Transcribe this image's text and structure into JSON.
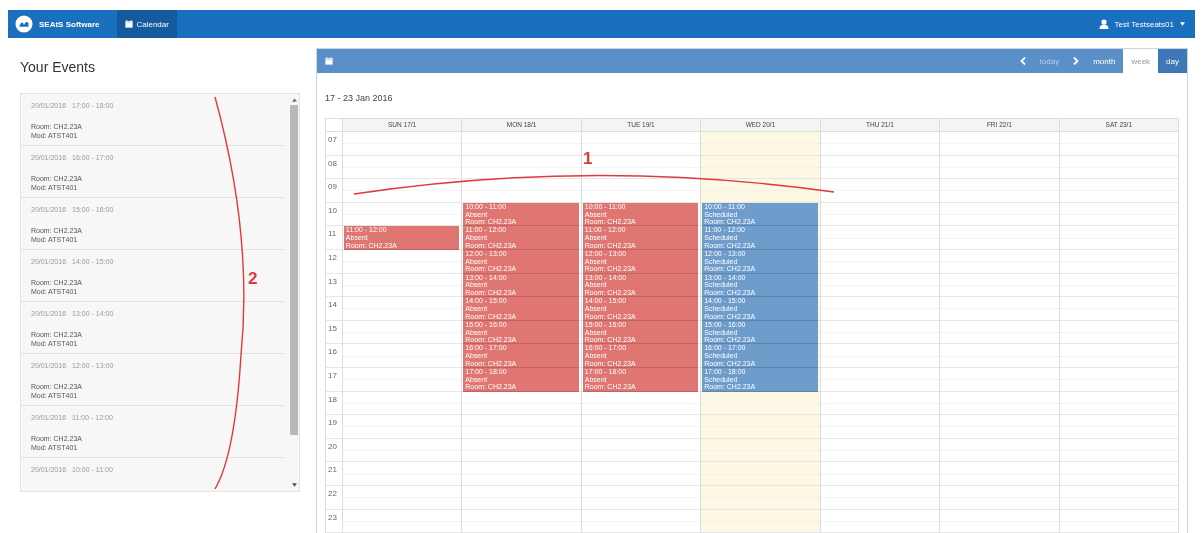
{
  "navbar": {
    "brand": "SEAtS Software",
    "items": [
      {
        "label": "Calendar",
        "selected": true
      }
    ],
    "user": "Test Testseats01"
  },
  "events_panel": {
    "title": "Your Events",
    "items": [
      {
        "date": "20/01/2016",
        "time": "17:00 - 18:00",
        "room": "Room: CH2.23A",
        "module": "Mod: ATST401"
      },
      {
        "date": "20/01/2016",
        "time": "16:00 - 17:00",
        "room": "Room: CH2.23A",
        "module": "Mod: ATST401"
      },
      {
        "date": "20/01/2016",
        "time": "15:00 - 16:00",
        "room": "Room: CH2.23A",
        "module": "Mod: ATST401"
      },
      {
        "date": "20/01/2016",
        "time": "14:00 - 15:00",
        "room": "Room: CH2.23A",
        "module": "Mod: ATST401"
      },
      {
        "date": "20/01/2016",
        "time": "13:00 - 14:00",
        "room": "Room: CH2.23A",
        "module": "Mod: ATST401"
      },
      {
        "date": "20/01/2016",
        "time": "12:00 - 13:00",
        "room": "Room: CH2.23A",
        "module": "Mod: ATST401"
      },
      {
        "date": "20/01/2016",
        "time": "11:00 - 12:00",
        "room": "Room: CH2.23A",
        "module": "Mod: ATST401"
      },
      {
        "date": "20/01/2016",
        "time": "10:00 - 11:00"
      }
    ]
  },
  "calendar": {
    "today_button": {
      "label": "today",
      "disabled": true
    },
    "views": [
      {
        "label": "month",
        "selected": false
      },
      {
        "label": "week",
        "selected": true
      },
      {
        "label": "day",
        "selected": false
      }
    ],
    "range_title": "17 - 23 Jan 2016",
    "hours": [
      "07",
      "08",
      "09",
      "10",
      "11",
      "12",
      "13",
      "14",
      "15",
      "16",
      "17",
      "18",
      "19",
      "20",
      "21",
      "22",
      "23"
    ],
    "columns": [
      {
        "label": "SUN 17/1",
        "today": false,
        "events": [
          {
            "kind": "absent",
            "time": "11:00 - 12:00",
            "status": "Absent",
            "room": "Room: CH2.23A"
          }
        ]
      },
      {
        "label": "MON 18/1",
        "today": false,
        "events": [
          {
            "kind": "absent",
            "time": "10:00 - 11:00",
            "status": "Absent",
            "room": "Room: CH2.23A"
          },
          {
            "kind": "absent",
            "time": "11:00 - 12:00",
            "status": "Absent",
            "room": "Room: CH2.23A"
          },
          {
            "kind": "absent",
            "time": "12:00 - 13:00",
            "status": "Absent",
            "room": "Room: CH2.23A"
          },
          {
            "kind": "absent",
            "time": "13:00 - 14:00",
            "status": "Absent",
            "room": "Room: CH2.23A"
          },
          {
            "kind": "absent",
            "time": "14:00 - 15:00",
            "status": "Absent",
            "room": "Room: CH2.23A"
          },
          {
            "kind": "absent",
            "time": "15:00 - 16:00",
            "status": "Absent",
            "room": "Room: CH2.23A"
          },
          {
            "kind": "absent",
            "time": "16:00 - 17:00",
            "status": "Absent",
            "room": "Room: CH2.23A"
          },
          {
            "kind": "absent",
            "time": "17:00 - 18:00",
            "status": "Absent",
            "room": "Room: CH2.23A"
          }
        ]
      },
      {
        "label": "TUE 19/1",
        "today": false,
        "events": [
          {
            "kind": "absent",
            "time": "10:00 - 11:00",
            "status": "Absent",
            "room": "Room: CH2.23A"
          },
          {
            "kind": "absent",
            "time": "11:00 - 12:00",
            "status": "Absent",
            "room": "Room: CH2.23A"
          },
          {
            "kind": "absent",
            "time": "12:00 - 13:00",
            "status": "Absent",
            "room": "Room: CH2.23A"
          },
          {
            "kind": "absent",
            "time": "13:00 - 14:00",
            "status": "Absent",
            "room": "Room: CH2.23A"
          },
          {
            "kind": "absent",
            "time": "14:00 - 15:00",
            "status": "Absent",
            "room": "Room: CH2.23A"
          },
          {
            "kind": "absent",
            "time": "15:00 - 16:00",
            "status": "Absent",
            "room": "Room: CH2.23A"
          },
          {
            "kind": "absent",
            "time": "16:00 - 17:00",
            "status": "Absent",
            "room": "Room: CH2.23A"
          },
          {
            "kind": "absent",
            "time": "17:00 - 18:00",
            "status": "Absent",
            "room": "Room: CH2.23A"
          }
        ]
      },
      {
        "label": "WED 20/1",
        "today": true,
        "events": [
          {
            "kind": "scheduled",
            "time": "10:00 - 11:00",
            "status": "Scheduled",
            "room": "Room: CH2.23A"
          },
          {
            "kind": "scheduled",
            "time": "11:00 - 12:00",
            "status": "Scheduled",
            "room": "Room: CH2.23A"
          },
          {
            "kind": "scheduled",
            "time": "12:00 - 13:00",
            "status": "Scheduled",
            "room": "Room: CH2.23A"
          },
          {
            "kind": "scheduled",
            "time": "13:00 - 14:00",
            "status": "Scheduled",
            "room": "Room: CH2.23A"
          },
          {
            "kind": "scheduled",
            "time": "14:00 - 15:00",
            "status": "Scheduled",
            "room": "Room: CH2.23A"
          },
          {
            "kind": "scheduled",
            "time": "15:00 - 16:00",
            "status": "Scheduled",
            "room": "Room: CH2.23A"
          },
          {
            "kind": "scheduled",
            "time": "16:00 - 17:00",
            "status": "Scheduled",
            "room": "Room: CH2.23A"
          },
          {
            "kind": "scheduled",
            "time": "17:00 - 18:00",
            "status": "Scheduled",
            "room": "Room: CH2.23A"
          }
        ]
      },
      {
        "label": "THU 21/1",
        "today": false
      },
      {
        "label": "FRI 22/1",
        "today": false
      },
      {
        "label": "SAT 23/1",
        "today": false
      }
    ]
  },
  "annotations": [
    {
      "label": "1",
      "kind": "arc"
    },
    {
      "label": "2",
      "kind": "bracket"
    }
  ]
}
